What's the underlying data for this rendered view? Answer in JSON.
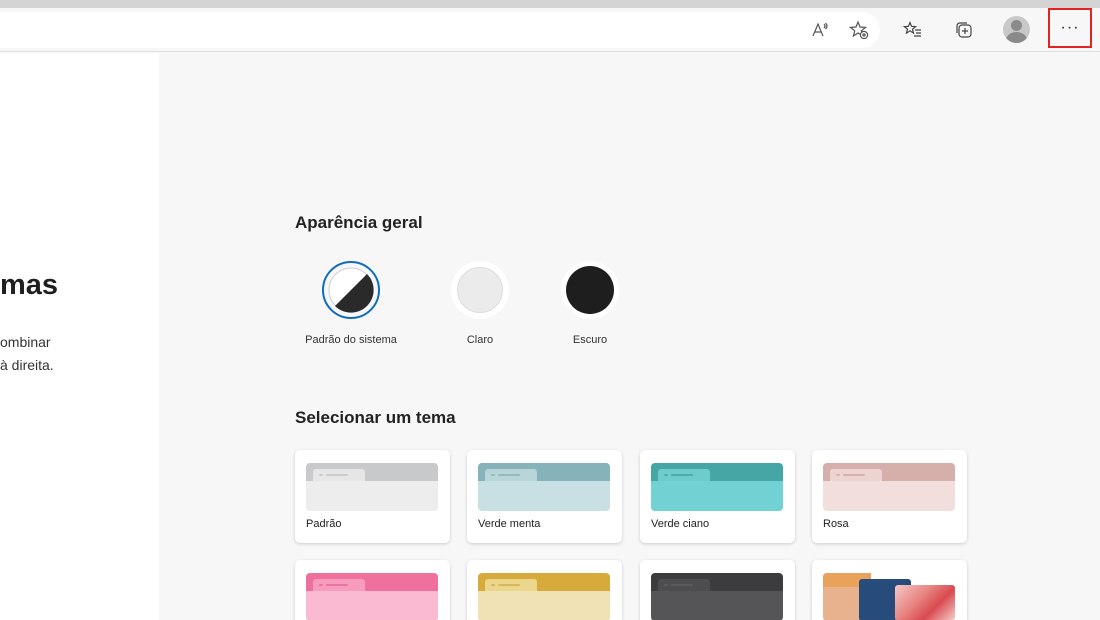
{
  "toolbar": {
    "icons": [
      "read-aloud-icon",
      "add-favorite-icon",
      "favorites-icon",
      "collections-icon",
      "profile-icon",
      "more-icon"
    ],
    "read_aloud_glyph": "A",
    "more_glyph": "···"
  },
  "left_panel": {
    "title": "mas",
    "desc_line1": "ombinar",
    "desc_line2": "à direita."
  },
  "appearance": {
    "title": "Aparência geral",
    "options": [
      {
        "label": "Padrão do sistema",
        "selected": true
      },
      {
        "label": "Claro",
        "selected": false
      },
      {
        "label": "Escuro",
        "selected": false
      }
    ]
  },
  "themes": {
    "title": "Selecionar um tema",
    "items": [
      {
        "label": "Padrão",
        "top_color": "#c7c9cb",
        "tab_color": "#e6e6e6",
        "bottom_color": "#ededed"
      },
      {
        "label": "Verde menta",
        "top_color": "#86b3b9",
        "tab_color": "#b8d5d9",
        "bottom_color": "#c8e0e3"
      },
      {
        "label": "Verde ciano",
        "top_color": "#46a6a6",
        "tab_color": "#6fcccd",
        "bottom_color": "#72d1d3"
      },
      {
        "label": "Rosa",
        "top_color": "#d6aeaa",
        "tab_color": "#edd3d1",
        "bottom_color": "#f2dedd"
      },
      {
        "label": "",
        "top_color": "#ef6f9d",
        "tab_color": "#f79cbd",
        "bottom_color": "#f9bad2"
      },
      {
        "label": "",
        "top_color": "#d7aa3c",
        "tab_color": "#ecd68c",
        "bottom_color": "#f0e2b5"
      },
      {
        "label": "",
        "top_color": "#3c3c3e",
        "tab_color": "#4d4d50",
        "bottom_color": "#555557"
      },
      {
        "label": "",
        "top_color": "#e8a25a",
        "tab_color": "#274b7a",
        "bottom_color": "#e9b28e"
      }
    ]
  },
  "colors": {
    "accent": "#0f6cbd",
    "highlight_border": "#e02424"
  }
}
